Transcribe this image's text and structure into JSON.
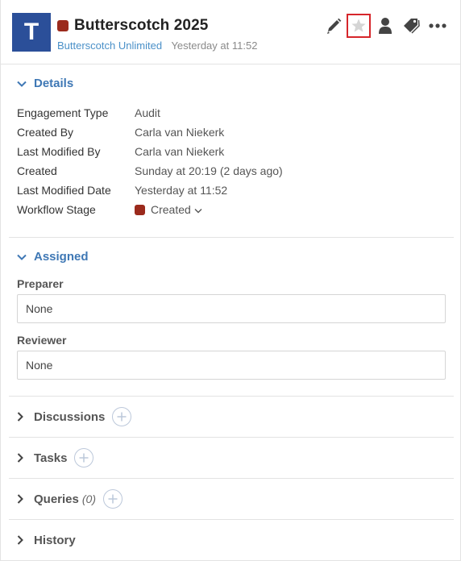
{
  "header": {
    "avatar_letter": "T",
    "title": "Butterscotch 2025",
    "client": "Butterscotch Unlimited",
    "timestamp": "Yesterday at 11:52",
    "stage_color": "#9b2a1c",
    "avatar_color": "#2b4f99",
    "toolbar": {
      "icons": [
        "pencil-icon",
        "star-icon",
        "user-icon",
        "tag-icon",
        "more-icon"
      ],
      "highlighted": "star-icon"
    }
  },
  "details": {
    "heading": "Details",
    "rows": [
      {
        "label": "Engagement Type",
        "value": "Audit"
      },
      {
        "label": "Created By",
        "value": "Carla van Niekerk"
      },
      {
        "label": "Last Modified By",
        "value": "Carla van Niekerk"
      },
      {
        "label": "Created",
        "value": "Sunday at 20:19 (2 days ago)"
      },
      {
        "label": "Last Modified Date",
        "value": "Yesterday at 11:52"
      },
      {
        "label": "Workflow Stage",
        "value": "Created"
      }
    ]
  },
  "assigned": {
    "heading": "Assigned",
    "preparer_label": "Preparer",
    "preparer_value": "None",
    "reviewer_label": "Reviewer",
    "reviewer_value": "None"
  },
  "sections": {
    "discussions": "Discussions",
    "tasks": "Tasks",
    "queries": "Queries",
    "queries_count": "(0)",
    "history": "History"
  }
}
